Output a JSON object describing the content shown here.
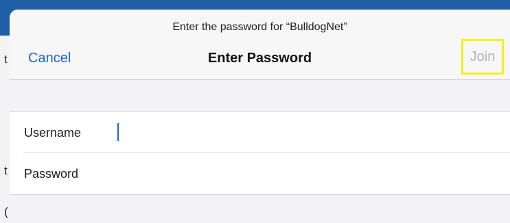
{
  "dialog": {
    "prompt": "Enter the password for “BulldogNet”",
    "title": "Enter Password",
    "cancel_label": "Cancel",
    "join_label": "Join"
  },
  "form": {
    "username": {
      "label": "Username",
      "value": ""
    },
    "password": {
      "label": "Password",
      "value": ""
    }
  },
  "background": {
    "letters": [
      "t",
      "t",
      "("
    ]
  },
  "colors": {
    "accent": "#1e66d0",
    "disabled_text": "#b3b3b8",
    "highlight_outline": "#f3f21a",
    "sheet_background": "#f2f2f7"
  }
}
